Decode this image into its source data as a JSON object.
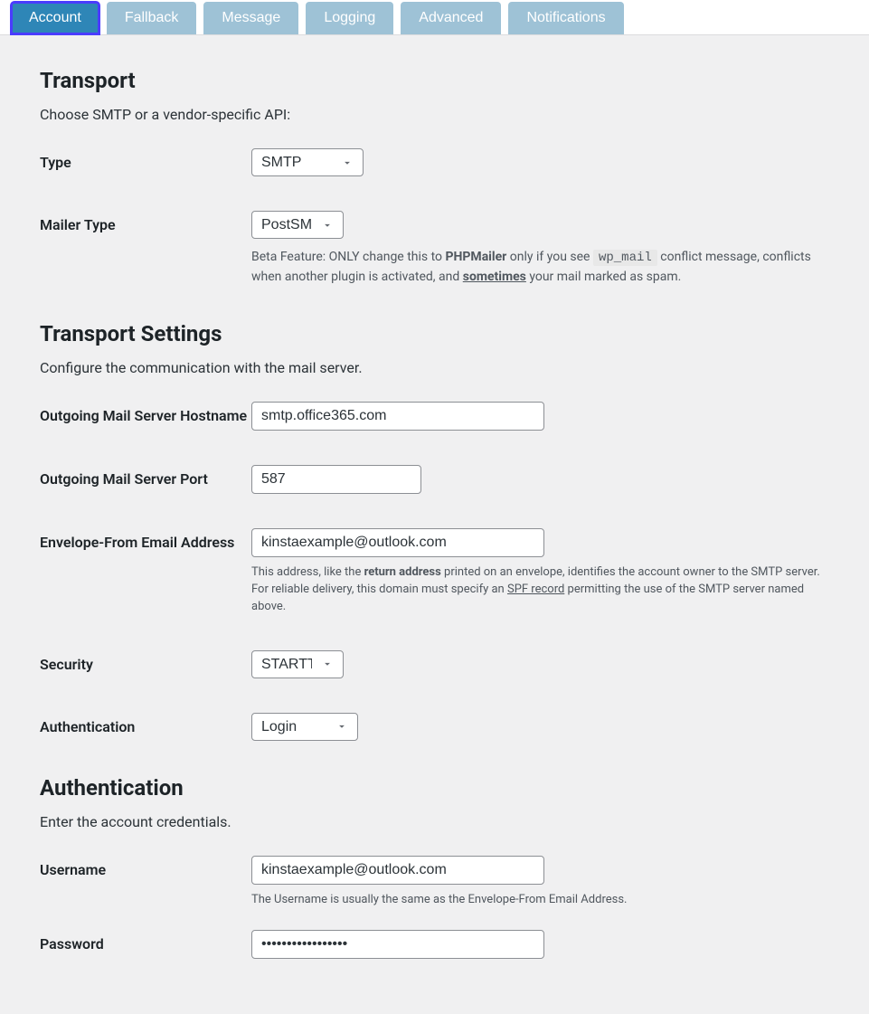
{
  "tabs": [
    {
      "label": "Account",
      "active": true
    },
    {
      "label": "Fallback",
      "active": false
    },
    {
      "label": "Message",
      "active": false
    },
    {
      "label": "Logging",
      "active": false
    },
    {
      "label": "Advanced",
      "active": false
    },
    {
      "label": "Notifications",
      "active": false
    }
  ],
  "transport": {
    "heading": "Transport",
    "sub": "Choose SMTP or a vendor-specific API:",
    "type_label": "Type",
    "type_value": "SMTP",
    "mailer_label": "Mailer Type",
    "mailer_value": "PostSMTP",
    "mailer_desc_pre": "Beta Feature: ONLY change this to ",
    "mailer_desc_bold": "PHPMailer",
    "mailer_desc_mid": " only if you see ",
    "mailer_desc_code": "wp_mail",
    "mailer_desc_after_code": " conflict message, conflicts when another plugin is activated, and ",
    "mailer_desc_sometimes": "sometimes",
    "mailer_desc_end": " your mail marked as spam."
  },
  "settings": {
    "heading": "Transport Settings",
    "sub": "Configure the communication with the mail server.",
    "hostname_label": "Outgoing Mail Server Hostname",
    "hostname_value": "smtp.office365.com",
    "port_label": "Outgoing Mail Server Port",
    "port_value": "587",
    "envelope_label": "Envelope-From Email Address",
    "envelope_value": "kinstaexample@outlook.com",
    "envelope_desc_pre": "This address, like the ",
    "envelope_desc_bold": "return address",
    "envelope_desc_mid": " printed on an envelope, identifies the account owner to the SMTP server. For reliable delivery, this domain must specify an ",
    "envelope_desc_link": "SPF record",
    "envelope_desc_end": " permitting the use of the SMTP server named above.",
    "security_label": "Security",
    "security_value": "STARTTLS",
    "auth_label": "Authentication",
    "auth_value": "Login"
  },
  "auth": {
    "heading": "Authentication",
    "sub": "Enter the account credentials.",
    "username_label": "Username",
    "username_value": "kinstaexample@outlook.com",
    "username_desc": "The Username is usually the same as the Envelope-From Email Address.",
    "password_label": "Password",
    "password_value": "•••••••••••••••••"
  }
}
